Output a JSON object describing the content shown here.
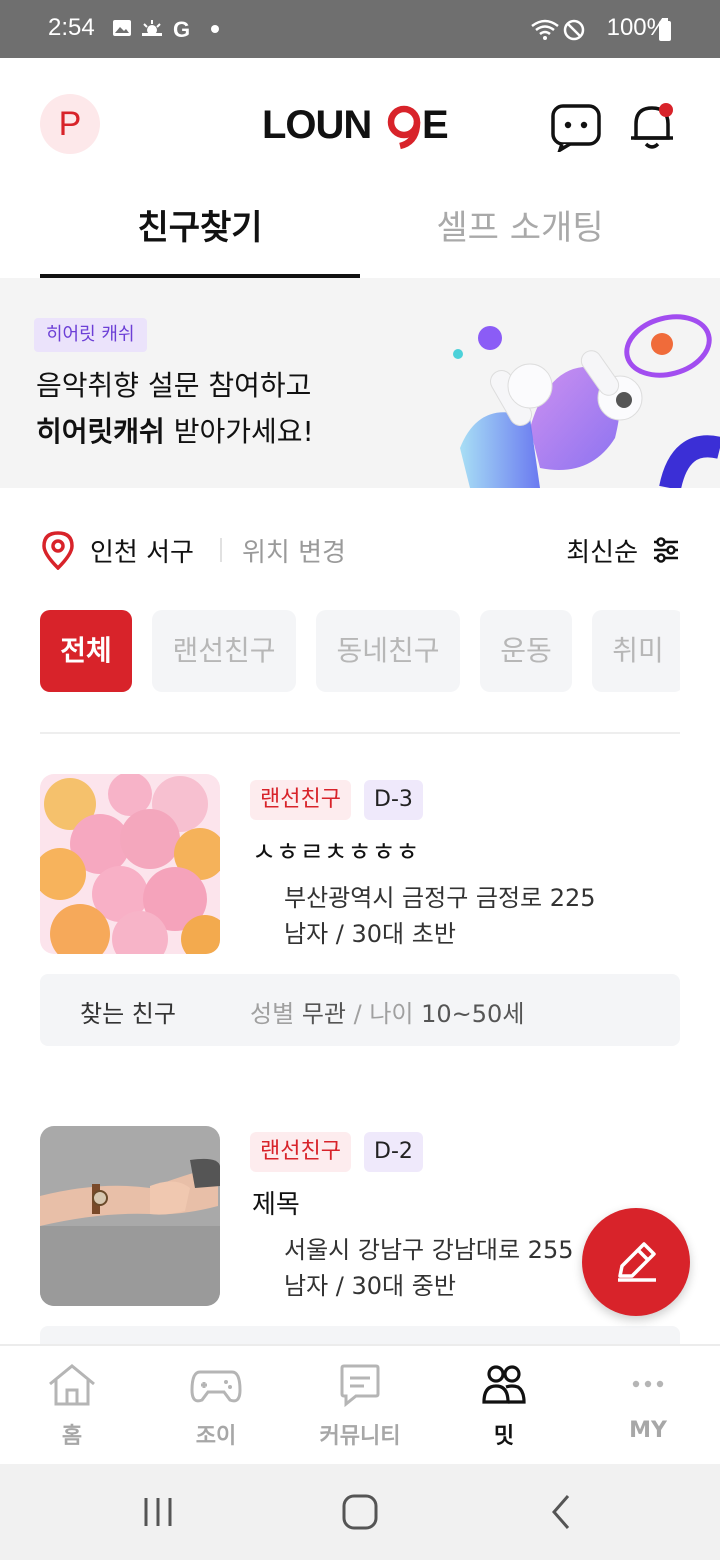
{
  "status_bar": {
    "time": "2:54",
    "battery": "100%",
    "icons": [
      "image-icon",
      "weather-icon",
      "google-icon",
      "dot-icon",
      "wifi-icon",
      "dnd-icon",
      "battery-icon"
    ]
  },
  "header": {
    "avatar_letter": "P",
    "logo_text": "LOUNGE",
    "chat_icon": "chat-icon",
    "bell_icon": "bell-icon",
    "notification_dot_color": "#d8232a"
  },
  "tabs": [
    {
      "label": "친구찾기",
      "active": true
    },
    {
      "label": "셀프 소개팅",
      "active": false
    }
  ],
  "banner": {
    "badge": "히어릿 캐쉬",
    "line1": "음악취향 설문 참여하고",
    "line2_bold": "히어릿캐쉬",
    "line2_rest": " 받아가세요!"
  },
  "location": {
    "name": "인천 서구",
    "change_label": "위치 변경",
    "sort_label": "최신순"
  },
  "chips": [
    "전체",
    "랜선친구",
    "동네친구",
    "운동",
    "취미"
  ],
  "cards": [
    {
      "category": "랜선친구",
      "dday": "D-3",
      "title": "ㅅㅎㄹㅊㅎㅎㅎ",
      "address": "부산광역시 금정구 금정로 225",
      "profile": "남자 / 30대 초반",
      "seek_label": "찾는 친구",
      "seek_gender_label": "성별",
      "seek_gender": "무관",
      "seek_age_label": "나이",
      "seek_age": "10~50세"
    },
    {
      "category": "랜선친구",
      "dday": "D-2",
      "title": "제목",
      "address": "서울시 강남구 강남대로 255",
      "profile": "남자 / 30대 중반"
    }
  ],
  "bottom_nav": [
    {
      "label": "홈",
      "icon": "home-icon",
      "active": false
    },
    {
      "label": "조이",
      "icon": "gamepad-icon",
      "active": false
    },
    {
      "label": "커뮤니티",
      "icon": "message-icon",
      "active": false
    },
    {
      "label": "밋",
      "icon": "people-icon",
      "active": true
    },
    {
      "label": "MY",
      "icon": "more-icon",
      "active": false
    }
  ],
  "colors": {
    "brand": "#d8232a",
    "purple_badge_bg": "#ebe3fb",
    "chip_bg": "#f4f5f7"
  }
}
